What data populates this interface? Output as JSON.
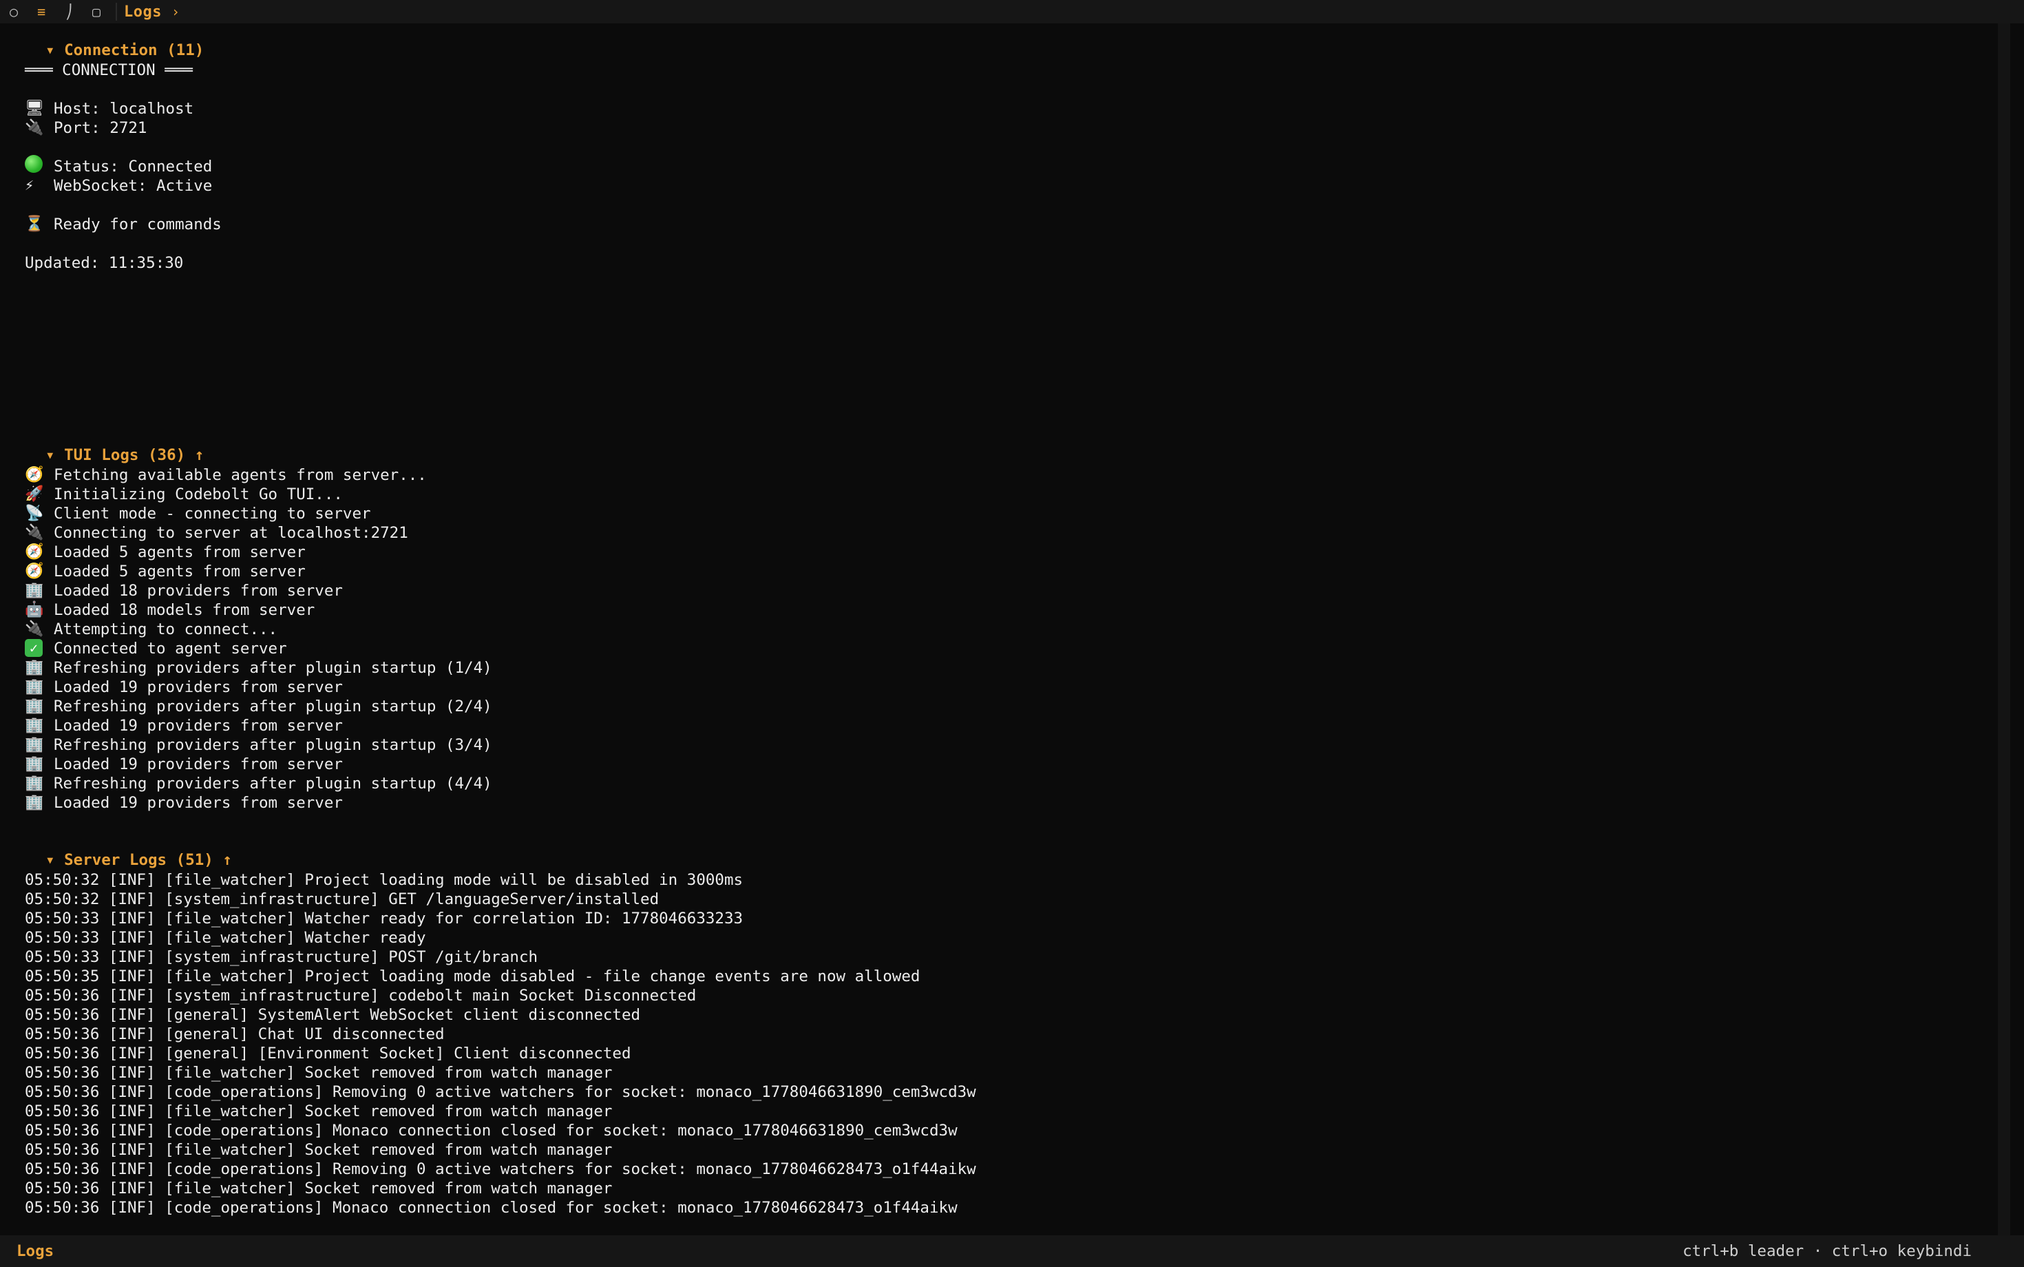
{
  "topbar": {
    "icons": [
      "circle-icon",
      "menu-icon",
      "chart-icon",
      "square-icon"
    ],
    "title": "Logs",
    "chevron": "›"
  },
  "connection": {
    "header": "▾ Connection (11)",
    "lines": [
      {
        "icon": "",
        "text": "═══ CONNECTION ═══"
      },
      {
        "blank": true
      },
      {
        "icon": "🖥",
        "text": "Host: localhost"
      },
      {
        "icon": "🔌",
        "text": "Port: 2721"
      },
      {
        "blank": true
      },
      {
        "icon": "green-dot",
        "text": "Status: Connected"
      },
      {
        "icon": "⚡",
        "text": "WebSocket: Active"
      },
      {
        "blank": true
      },
      {
        "icon": "⏳",
        "text": "Ready for commands"
      },
      {
        "blank": true
      },
      {
        "icon": "",
        "text": "Updated: 11:35:30"
      }
    ]
  },
  "tui_logs": {
    "header": "▾ TUI Logs (36) ↑",
    "lines": [
      {
        "icon": "🧭",
        "text": "Fetching available agents from server..."
      },
      {
        "icon": "🚀",
        "text": "Initializing Codebolt Go TUI..."
      },
      {
        "icon": "📡",
        "text": "Client mode - connecting to server"
      },
      {
        "icon": "🔌",
        "text": "Connecting to server at localhost:2721"
      },
      {
        "icon": "🧭",
        "text": "Loaded 5 agents from server"
      },
      {
        "icon": "🧭",
        "text": "Loaded 5 agents from server"
      },
      {
        "icon": "🏢",
        "text": "Loaded 18 providers from server"
      },
      {
        "icon": "🤖",
        "text": "Loaded 18 models from server"
      },
      {
        "icon": "🔌",
        "text": "Attempting to connect..."
      },
      {
        "icon": "check",
        "text": "Connected to agent server"
      },
      {
        "icon": "🏢",
        "text": "Refreshing providers after plugin startup (1/4)"
      },
      {
        "icon": "🏢",
        "text": "Loaded 19 providers from server"
      },
      {
        "icon": "🏢",
        "text": "Refreshing providers after plugin startup (2/4)"
      },
      {
        "icon": "🏢",
        "text": "Loaded 19 providers from server"
      },
      {
        "icon": "🏢",
        "text": "Refreshing providers after plugin startup (3/4)"
      },
      {
        "icon": "🏢",
        "text": "Loaded 19 providers from server"
      },
      {
        "icon": "🏢",
        "text": "Refreshing providers after plugin startup (4/4)"
      },
      {
        "icon": "🏢",
        "text": "Loaded 19 providers from server"
      }
    ]
  },
  "server_logs": {
    "header": "▾ Server Logs (51) ↑",
    "lines": [
      "05:50:32 [INF] [file_watcher] Project loading mode will be disabled in 3000ms",
      "05:50:32 [INF] [system_infrastructure] GET /languageServer/installed",
      "05:50:33 [INF] [file_watcher] Watcher ready for correlation ID: 1778046633233",
      "05:50:33 [INF] [file_watcher] Watcher ready",
      "05:50:33 [INF] [system_infrastructure] POST /git/branch",
      "05:50:35 [INF] [file_watcher] Project loading mode disabled - file change events are now allowed",
      "05:50:36 [INF] [system_infrastructure] codebolt main Socket Disconnected",
      "05:50:36 [INF] [general] SystemAlert WebSocket client disconnected",
      "05:50:36 [INF] [general] Chat UI disconnected",
      "05:50:36 [INF] [general] [Environment Socket] Client disconnected",
      "05:50:36 [INF] [file_watcher] Socket removed from watch manager",
      "05:50:36 [INF] [code_operations] Removing 0 active watchers for socket: monaco_1778046631890_cem3wcd3w",
      "05:50:36 [INF] [file_watcher] Socket removed from watch manager",
      "05:50:36 [INF] [code_operations] Monaco connection closed for socket: monaco_1778046631890_cem3wcd3w",
      "05:50:36 [INF] [file_watcher] Socket removed from watch manager",
      "05:50:36 [INF] [code_operations] Removing 0 active watchers for socket: monaco_1778046628473_o1f44aikw",
      "05:50:36 [INF] [file_watcher] Socket removed from watch manager",
      "05:50:36 [INF] [code_operations] Monaco connection closed for socket: monaco_1778046628473_o1f44aikw"
    ]
  },
  "statusbar": {
    "left": "Logs",
    "right": "ctrl+b leader · ctrl+o keybindi"
  },
  "colors": {
    "accent": "#e9a23b",
    "background": "#0b0b0b",
    "bar": "#161616",
    "text": "#ececec"
  }
}
